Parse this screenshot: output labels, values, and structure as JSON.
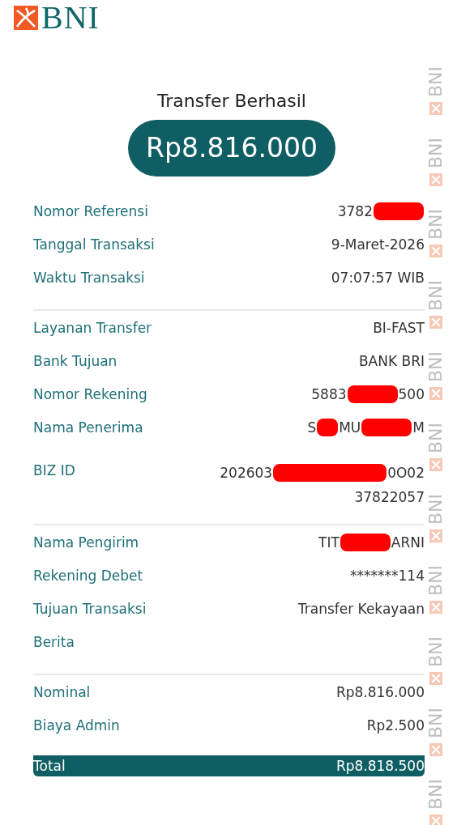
{
  "logo": {
    "text": "BNI"
  },
  "title": "Transfer Berhasil",
  "amount": "Rp8.816.000",
  "sections": [
    {
      "rows": [
        {
          "label": "Nomor Referensi",
          "lines": [
            [
              {
                "kind": "text",
                "text": "3782"
              },
              {
                "kind": "redaction"
              }
            ]
          ]
        },
        {
          "label": "Tanggal Transaksi",
          "lines": [
            [
              {
                "kind": "text",
                "text": "9-Maret-2026"
              }
            ]
          ]
        },
        {
          "label": "Waktu Transaksi",
          "lines": [
            [
              {
                "kind": "text",
                "text": "07:07:57 WIB"
              }
            ]
          ]
        }
      ]
    },
    {
      "rows": [
        {
          "label": "Layanan Transfer",
          "lines": [
            [
              {
                "kind": "text",
                "text": "BI-FAST"
              }
            ]
          ]
        },
        {
          "label": "Bank Tujuan",
          "lines": [
            [
              {
                "kind": "text",
                "text": "BANK BRI"
              }
            ]
          ]
        },
        {
          "label": "Nomor Rekening",
          "lines": [
            [
              {
                "kind": "text",
                "text": "5883"
              },
              {
                "kind": "redaction"
              },
              {
                "kind": "text",
                "text": "500"
              }
            ]
          ]
        },
        {
          "label": "Nama Penerima",
          "lines": [
            [
              {
                "kind": "text",
                "text": "S"
              },
              {
                "kind": "redaction-small"
              },
              {
                "kind": "text",
                "text": "MU"
              },
              {
                "kind": "redaction"
              },
              {
                "kind": "text",
                "text": "M"
              }
            ]
          ]
        },
        {
          "label": "BIZ ID",
          "lines": [
            [
              {
                "kind": "text",
                "text": "202603"
              },
              {
                "kind": "redaction-long"
              },
              {
                "kind": "text",
                "text": "0O02"
              }
            ],
            [
              {
                "kind": "text",
                "text": "37822057"
              }
            ]
          ]
        }
      ]
    },
    {
      "rows": [
        {
          "label": "Nama Pengirim",
          "lines": [
            [
              {
                "kind": "text",
                "text": "TIT"
              },
              {
                "kind": "redaction"
              },
              {
                "kind": "text",
                "text": "ARNI"
              }
            ]
          ]
        },
        {
          "label": "Rekening Debet",
          "lines": [
            [
              {
                "kind": "text",
                "text": "*******114"
              }
            ]
          ]
        },
        {
          "label": "Tujuan Transaksi",
          "lines": [
            [
              {
                "kind": "text",
                "text": "Transfer Kekayaan"
              }
            ]
          ]
        },
        {
          "label": "Berita",
          "lines": []
        }
      ]
    },
    {
      "rows": [
        {
          "label": "Nominal",
          "lines": [
            [
              {
                "kind": "text",
                "text": "Rp8.816.000"
              }
            ]
          ]
        },
        {
          "label": "Biaya Admin",
          "lines": [
            [
              {
                "kind": "text",
                "text": "Rp2.500"
              }
            ]
          ]
        },
        {
          "label": "Total",
          "kind": "total",
          "lines": [
            [
              {
                "kind": "text",
                "text": "Rp8.818.500"
              }
            ]
          ]
        }
      ]
    }
  ],
  "watermark": [
    "BNI",
    "BNI",
    "BNI",
    "BNI",
    "BNI",
    "BNI",
    "BNI",
    "BNI",
    "BNI",
    "BNI",
    "BNI"
  ]
}
